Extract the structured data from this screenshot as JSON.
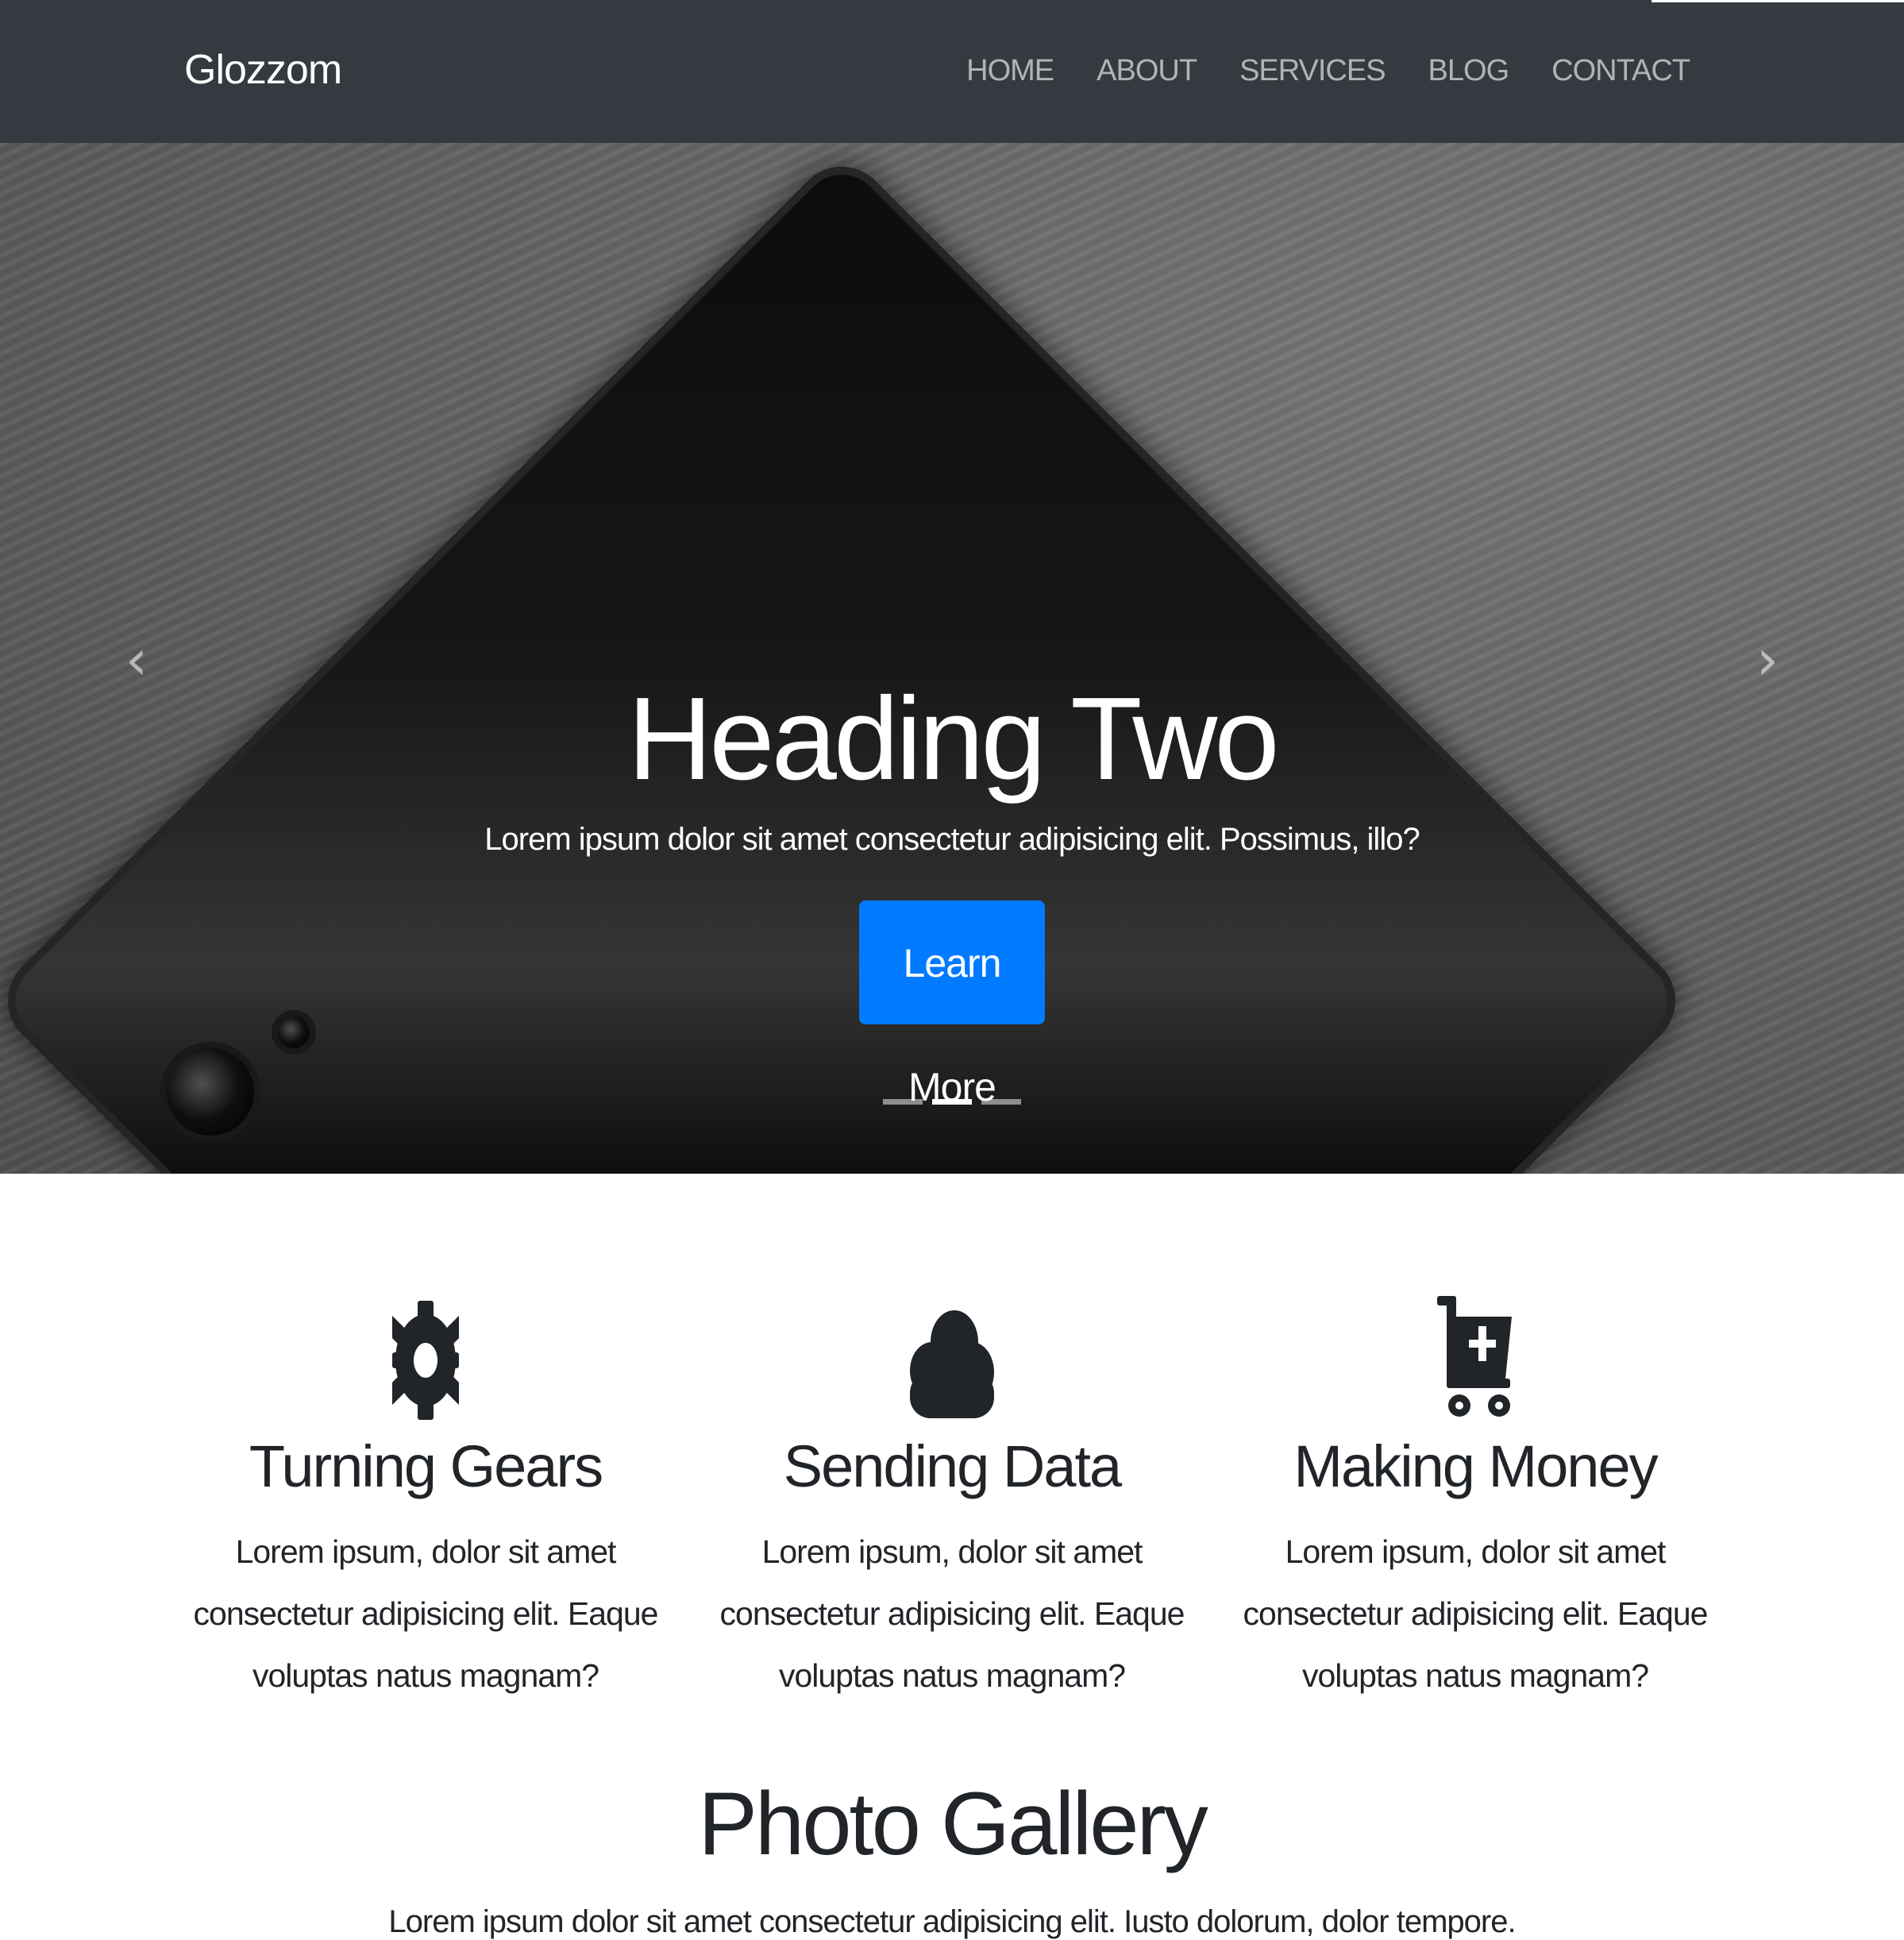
{
  "navbar": {
    "brand": "Glozzom",
    "links": [
      {
        "label": "HOME"
      },
      {
        "label": "ABOUT"
      },
      {
        "label": "SERVICES"
      },
      {
        "label": "BLOG"
      },
      {
        "label": "CONTACT"
      }
    ]
  },
  "hero": {
    "heading": "Heading Two",
    "text": "Lorem ipsum dolor sit amet consectetur adipisicing elit. Possimus, illo?",
    "button_label": "Learn More",
    "prev_icon": "chevron-left-icon",
    "next_icon": "chevron-right-icon",
    "slide_count": 3,
    "active_slide": 2
  },
  "features": [
    {
      "icon": "gear-icon",
      "title": "Turning Gears",
      "text": "Lorem ipsum, dolor sit amet consectetur adipisicing elit. Eaque voluptas natus magnam?"
    },
    {
      "icon": "cloud-icon",
      "title": "Sending Data",
      "text": "Lorem ipsum, dolor sit amet consectetur adipisicing elit. Eaque voluptas natus magnam?"
    },
    {
      "icon": "cart-plus-icon",
      "title": "Making Money",
      "text": "Lorem ipsum, dolor sit amet consectetur adipisicing elit. Eaque voluptas natus magnam?"
    }
  ],
  "gallery": {
    "title": "Photo Gallery",
    "subtitle": "Lorem ipsum dolor sit amet consectetur adipisicing elit. Iusto dolorum, dolor tempore."
  },
  "colors": {
    "navbar_bg": "#343a40",
    "primary": "#007bff",
    "text": "#212529"
  }
}
